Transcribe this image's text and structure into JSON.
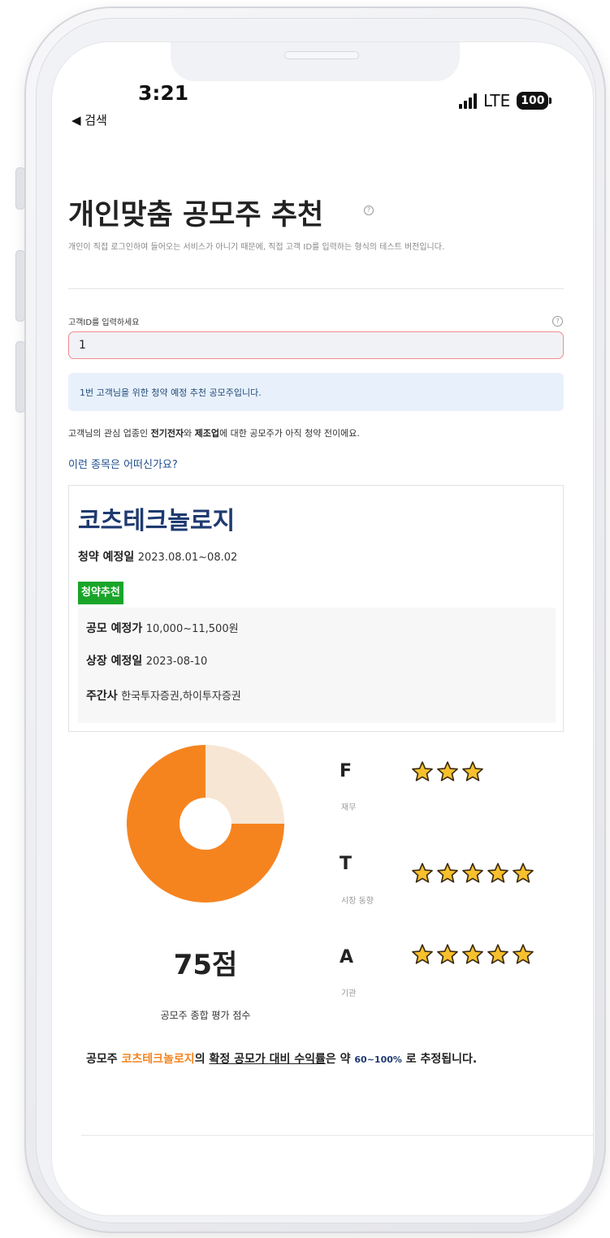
{
  "status_bar": {
    "time": "3:21",
    "back_label": "◀ 검색",
    "network": "LTE",
    "battery": "100"
  },
  "page": {
    "title": "개인맞춤 공모주 추천",
    "subtitle": "개인이 직접 로그인하여 들어오는 서비스가 아니기 때문에, 직접 고객 ID를 입력하는 형식의 테스트 버전입니다.",
    "help_glyph": "?"
  },
  "customer_input": {
    "label": "고객ID를 입력하세요",
    "value": "1",
    "help_glyph": "?"
  },
  "info_message": "1번 고객님을 위한 청약 예정 추천 공모주입니다.",
  "interest": {
    "prefix": "고객님의 관심 업종인 ",
    "industry1": "전기전자",
    "mid": "와 ",
    "industry2": "제조업",
    "suffix": "에 대한 공모주가 아직 청약 전이에요."
  },
  "suggest_text": "이런 종목은 어떠신가요?",
  "recommendation": {
    "company": "코츠테크놀로지",
    "subscription_label": "청약 예정일",
    "subscription_value": "2023.08.01~08.02",
    "badge": "청약추천",
    "price_label": "공모 예정가",
    "price_value": "10,000~11,500원",
    "listing_label": "상장 예정일",
    "listing_value": "2023-08-10",
    "underwriter_label": "주간사",
    "underwriter_value": "한국투자증권,하이투자증권"
  },
  "score": {
    "value": 75,
    "label": "75점",
    "caption": "공모주 종합 평가 점수",
    "colors": {
      "filled": "#f5841f",
      "remaining": "#f8e6d4"
    }
  },
  "metrics": [
    {
      "letter": "F",
      "label": "재무",
      "stars": 3
    },
    {
      "letter": "T",
      "label": "시장 동향",
      "stars": 5
    },
    {
      "letter": "A",
      "label": "기관",
      "stars": 5
    }
  ],
  "conclusion": {
    "prefix": "공모주 ",
    "company": "코츠테크놀로지",
    "mid1": "의 ",
    "underlined": "확정 공모가 대비 수익률",
    "mid2": "은 약 ",
    "range": "60~100%",
    "suffix": " 로 추정됩니다."
  }
}
